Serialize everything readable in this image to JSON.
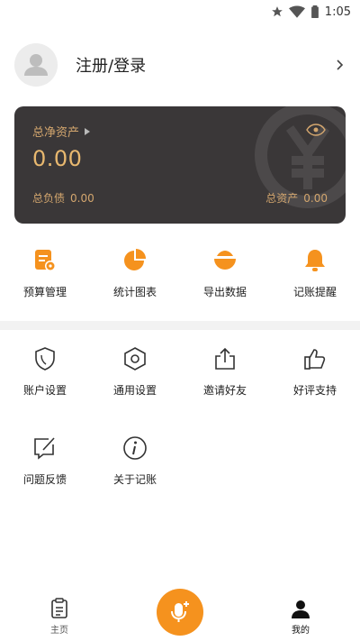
{
  "status_bar": {
    "time": "1:05",
    "icons": [
      "star-icon",
      "wifi-icon",
      "battery-icon"
    ]
  },
  "profile": {
    "login_text": "注册/登录",
    "avatar_icon": "user-avatar-icon"
  },
  "asset_card": {
    "net_assets_label": "总净资产",
    "net_assets_value": "0.00",
    "liabilities_label": "总负债",
    "liabilities_value": "0.00",
    "total_assets_label": "总资产",
    "total_assets_value": "0.00"
  },
  "primary_features": [
    {
      "label": "预算管理",
      "icon": "budget-icon"
    },
    {
      "label": "统计图表",
      "icon": "pie-chart-icon"
    },
    {
      "label": "导出数据",
      "icon": "export-icon"
    },
    {
      "label": "记账提醒",
      "icon": "bell-icon"
    }
  ],
  "settings_row1": [
    {
      "label": "账户设置",
      "icon": "shield-icon"
    },
    {
      "label": "通用设置",
      "icon": "hexagon-settings-icon"
    },
    {
      "label": "邀请好友",
      "icon": "share-icon"
    },
    {
      "label": "好评支持",
      "icon": "thumbs-up-icon"
    }
  ],
  "settings_row2": [
    {
      "label": "问题反馈",
      "icon": "feedback-icon"
    },
    {
      "label": "关于记账",
      "icon": "info-icon"
    }
  ],
  "bottom_nav": {
    "home_label": "主页",
    "mine_label": "我的",
    "colors": {
      "accent": "#f5921e",
      "card_bg": "#3a3738",
      "gold": "#d3a66e"
    }
  }
}
